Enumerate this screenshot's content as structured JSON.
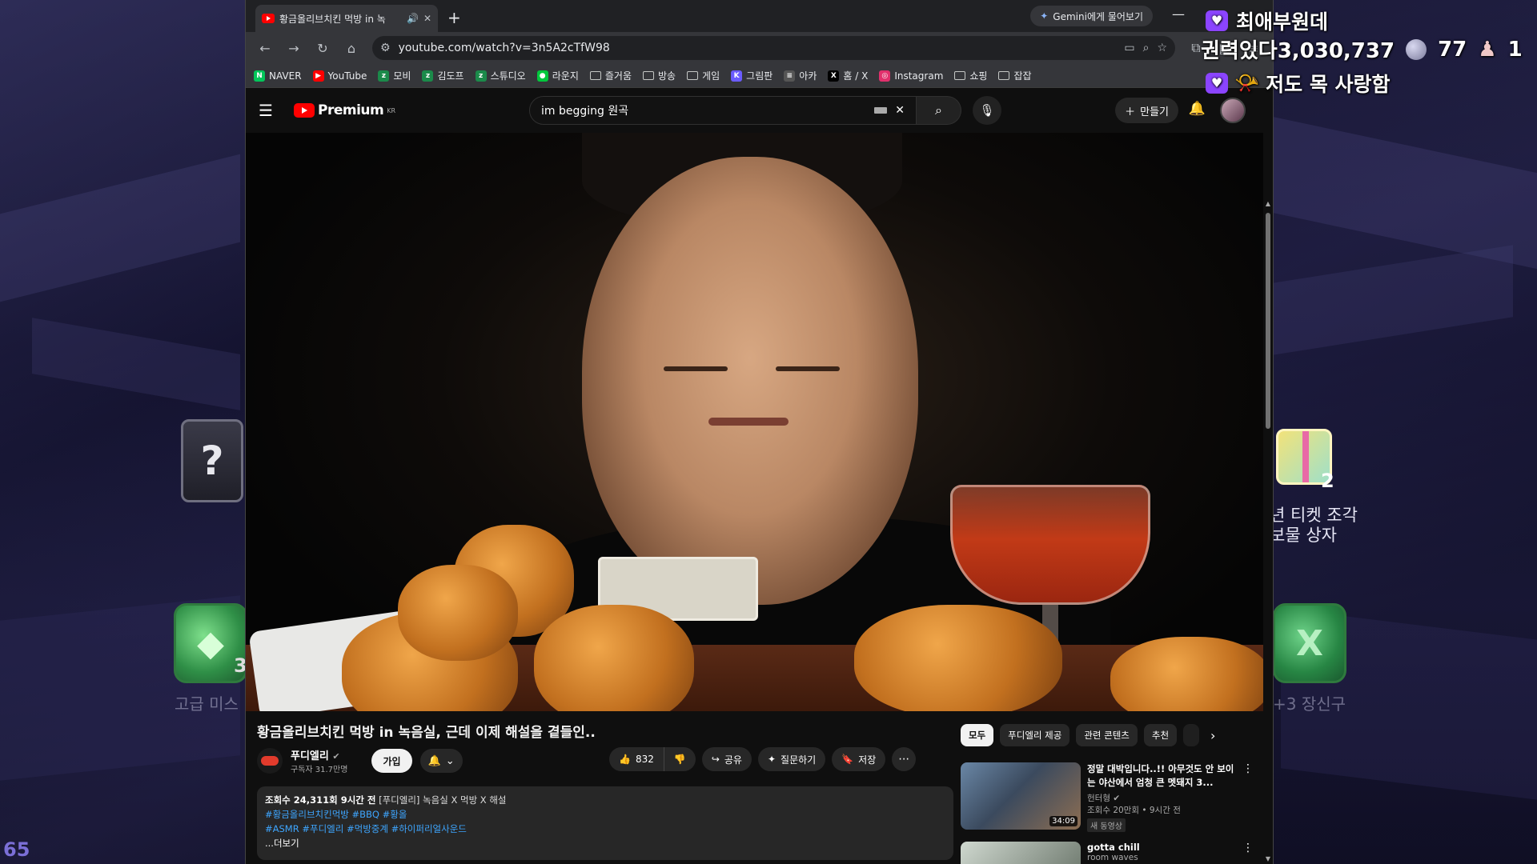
{
  "game": {
    "fps": "65",
    "gem_left_count": "3",
    "gem_left_label": "고급 미스",
    "gem_right_count": "+3",
    "gem_right_label": "장신구",
    "gift_count": "2",
    "gift_label_1": "년 티켓 조각",
    "gift_label_2": "보물 상자",
    "unknown_box": "?"
  },
  "overlay": {
    "line1": "최애부원데",
    "line2_text": "권력있다",
    "line2_number": "3,030,737",
    "coin_count": "77",
    "pawn_count": "1",
    "line3": "저도 목 사랑함"
  },
  "browser": {
    "tab_title": "황금올리브치킨 먹방 in 녹",
    "gemini_label": "Gemini에게 물어보기",
    "url": "youtube.com/watch?v=3n5A2cTfW98",
    "bookmarks": [
      {
        "label": "NAVER",
        "color": "#03c75a",
        "glyph": "N"
      },
      {
        "label": "YouTube",
        "color": "#ff0000",
        "glyph": "▶"
      },
      {
        "label": "모비",
        "color": "#1b8a4a",
        "glyph": "z"
      },
      {
        "label": "김도프",
        "color": "#1b8a4a",
        "glyph": "z"
      },
      {
        "label": "스튜디오",
        "color": "#1b8a4a",
        "glyph": "z"
      },
      {
        "label": "라운지",
        "color": "#00c73c",
        "glyph": "●"
      },
      {
        "label": "즐거움",
        "folder": true
      },
      {
        "label": "방송",
        "folder": true
      },
      {
        "label": "게임",
        "folder": true
      },
      {
        "label": "그림판",
        "color": "#6b5cff",
        "glyph": "K"
      },
      {
        "label": "아카",
        "color": "#555555",
        "glyph": "≡"
      },
      {
        "label": "홈 / X",
        "color": "#000000",
        "glyph": "X"
      },
      {
        "label": "Instagram",
        "color": "#e1306c",
        "glyph": "◎"
      },
      {
        "label": "쇼핑",
        "folder": true
      },
      {
        "label": "잡잡",
        "folder": true
      }
    ]
  },
  "youtube": {
    "logo_word": "Premium",
    "logo_region": "KR",
    "search_query": "im begging 원곡",
    "create_label": "만들기",
    "video": {
      "title": "황금올리브치킨 먹방 in 녹음실, 근데 이제 해설을 곁들인..",
      "channel_name": "푸디엘리",
      "channel_subs": "구독자 31.7만명",
      "join_label": "가입",
      "like_count": "832",
      "share_label": "공유",
      "ask_label": "질문하기",
      "save_label": "저장",
      "desc_views": "조회수 24,311회  9시간 전",
      "desc_tag": "[푸디엘리] 녹음실 X 먹방 X 해설",
      "desc_hashtags_1": "#황금올리브치킨먹방 #BBQ #황올",
      "desc_hashtags_2": "#ASMR #푸디엘리 #먹방중계 #하이퍼리얼사운드",
      "desc_more": "...더보기"
    },
    "chips": [
      "모두",
      "푸디엘리 제공",
      "관련 콘텐츠",
      "추천"
    ],
    "recommendations": [
      {
        "title": "정말 대박입니다..!! 아무것도 안 보이는 야산에서 엄청 큰 멧돼지 3...",
        "channel": "헌터형",
        "stats": "조회수 20만회 • 9시간 전",
        "badge": "새 동영상",
        "duration": "34:09"
      },
      {
        "title": "gotta chill",
        "channel": "room waves"
      }
    ]
  }
}
